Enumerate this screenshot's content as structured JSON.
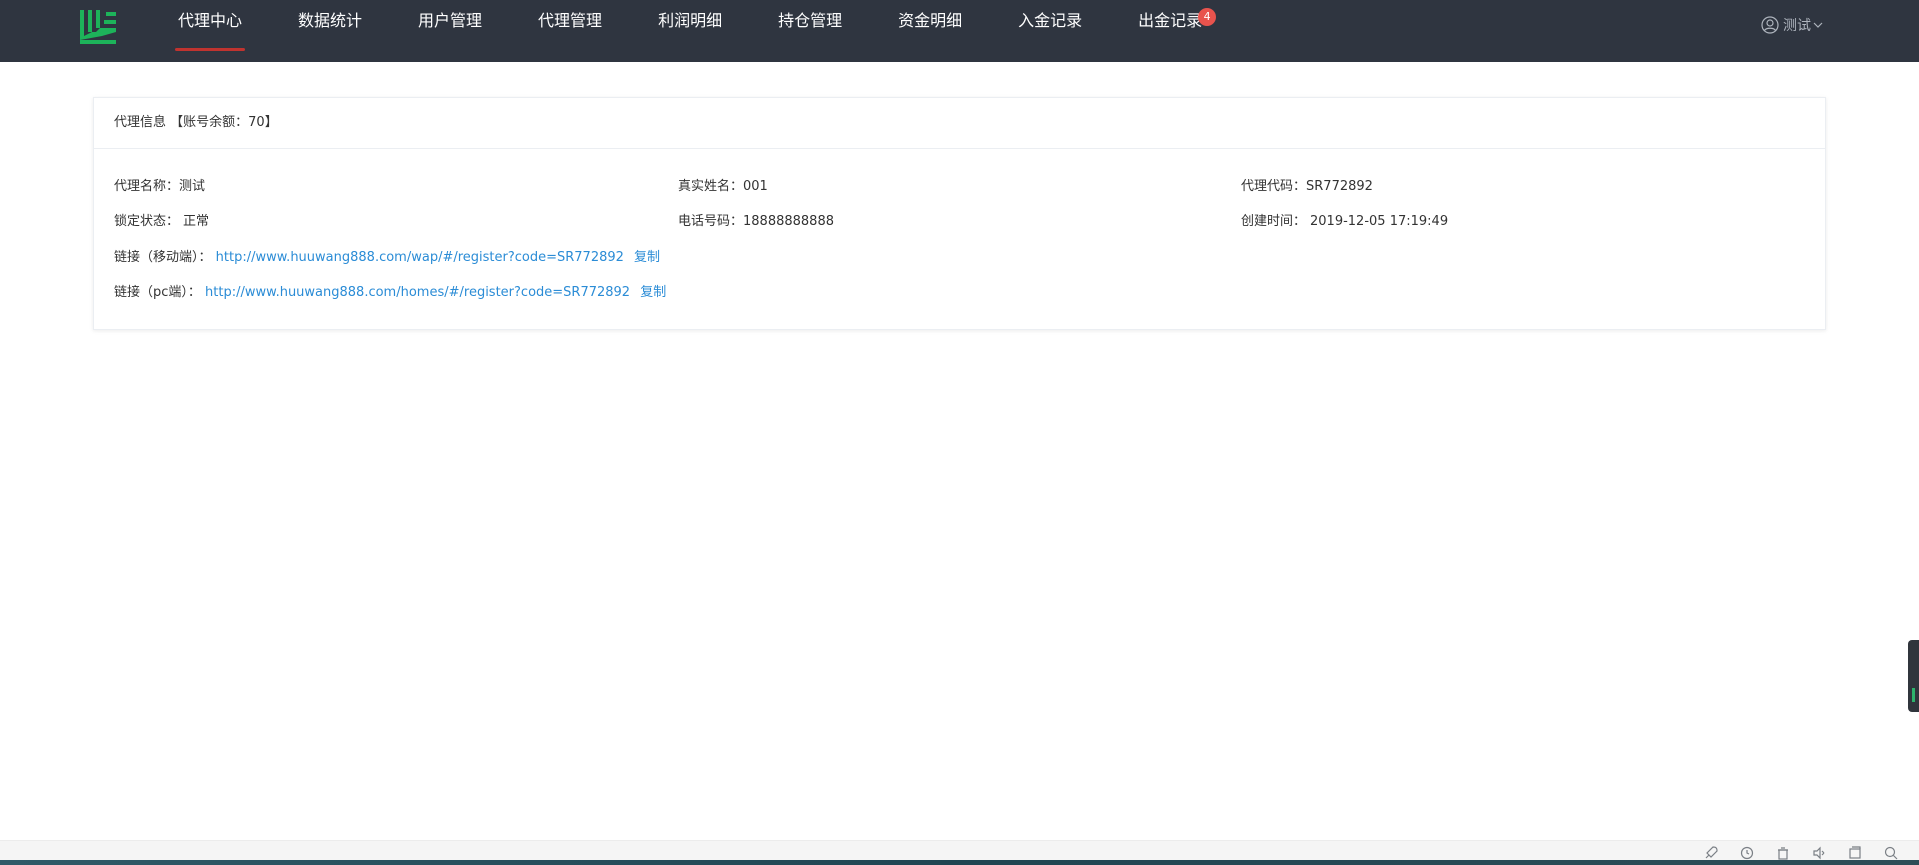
{
  "nav": {
    "items": [
      {
        "label": "代理中心",
        "active": true
      },
      {
        "label": "数据统计"
      },
      {
        "label": "用户管理"
      },
      {
        "label": "代理管理"
      },
      {
        "label": "利润明细"
      },
      {
        "label": "持仓管理"
      },
      {
        "label": "资金明细"
      },
      {
        "label": "入金记录"
      },
      {
        "label": "出金记录",
        "badge": "4"
      }
    ],
    "user_name": "测试",
    "logo_icon": "leaf-stripes-logo",
    "accent": "#c0332f",
    "badge_color": "#e8534d",
    "logo_color": "#1db35a"
  },
  "agent_info": {
    "header_title": "代理信息",
    "balance_label": "【账号余额：70】",
    "name_label": "代理名称：",
    "name_value": "测试",
    "real_name_label": "真实姓名：",
    "real_name_value": "001",
    "code_label": "代理代码：",
    "code_value": "SR772892",
    "lock_label": "锁定状态：",
    "lock_value": "正常",
    "phone_label": "电话号码：",
    "phone_value": "18888888888",
    "created_label": "创建时间：",
    "created_value": "2019-12-05 17:19:49",
    "mobile_link_label": "链接（移动端）：",
    "mobile_link": "http://www.huuwang888.com/wap/#/register?code=SR772892",
    "pc_link_label": "链接（pc端）：",
    "pc_link": "http://www.huuwang888.com/homes/#/register?code=SR772892",
    "copy_label": "复制",
    "link_color": "#2b8cd6"
  },
  "bottom_icons": [
    "rocket-icon",
    "refresh-icon",
    "trash-icon",
    "volume-icon",
    "window-icon",
    "search-icon"
  ]
}
